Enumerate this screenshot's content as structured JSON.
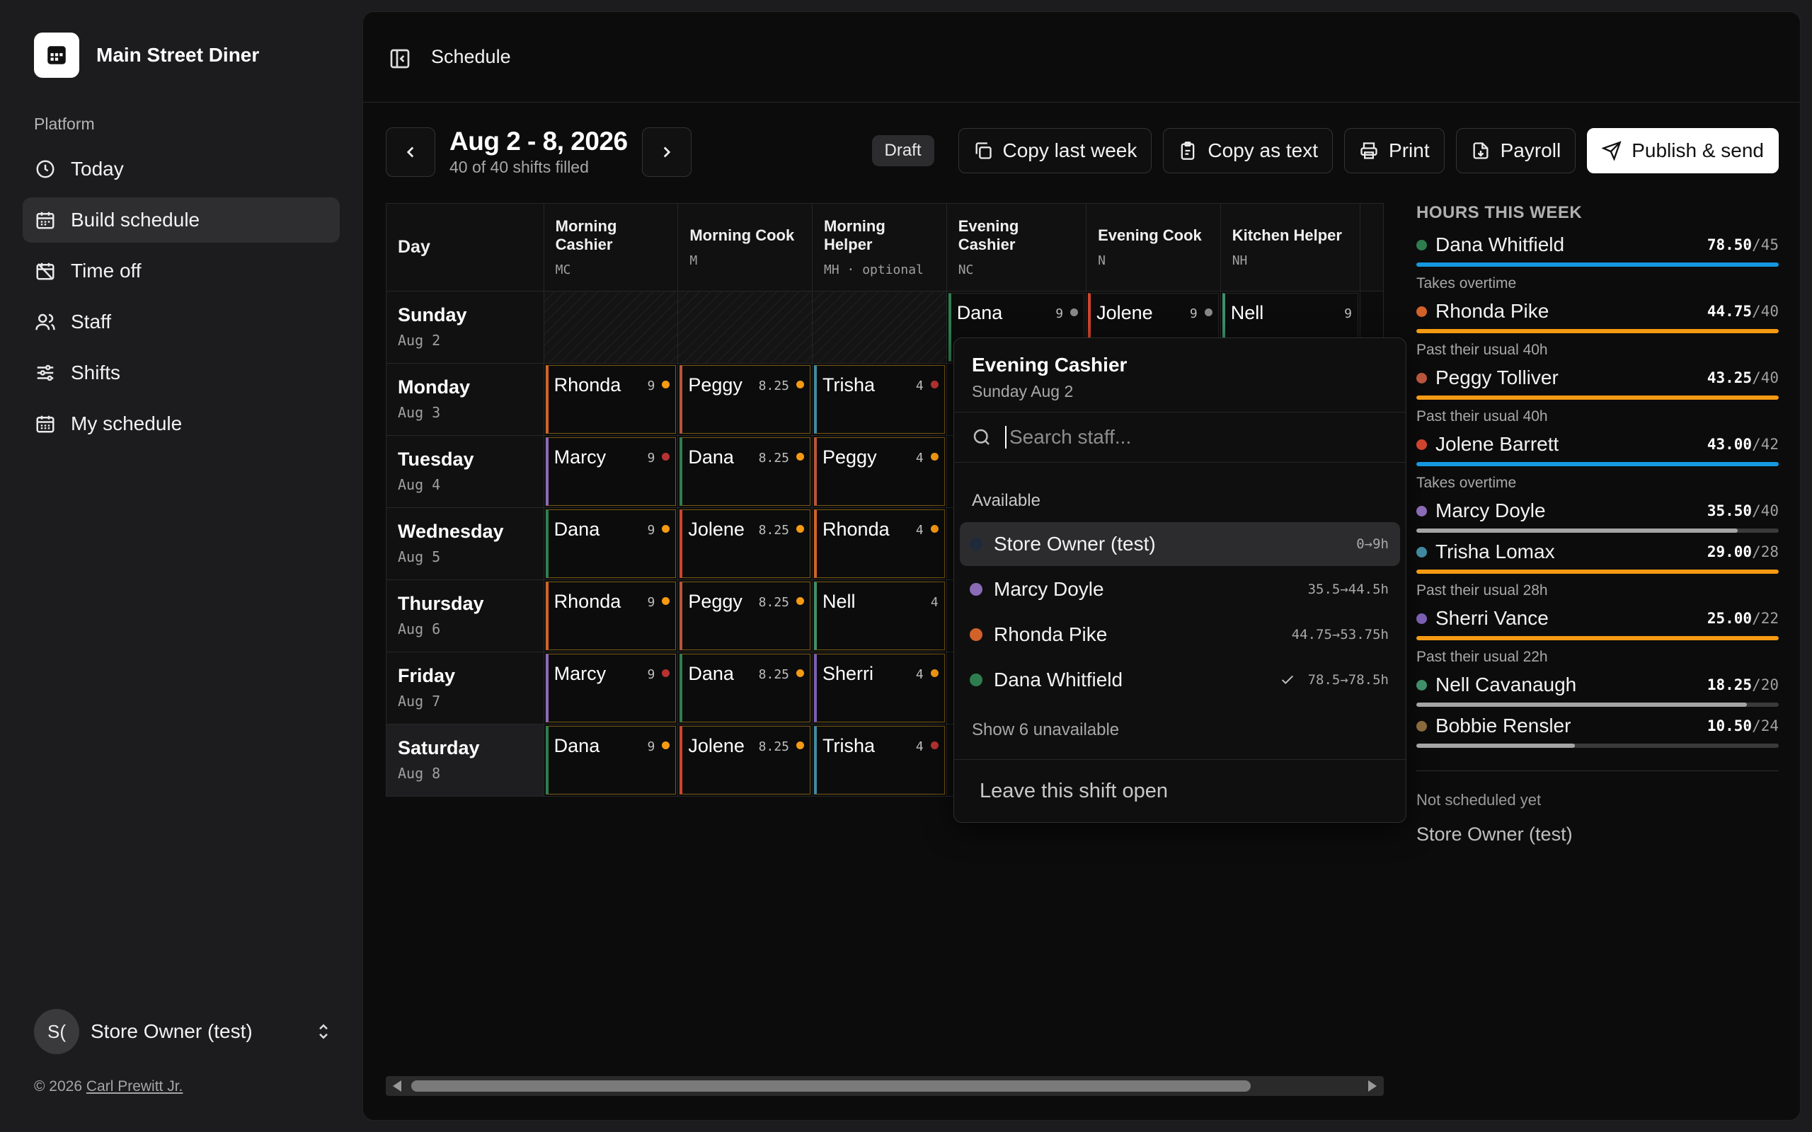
{
  "sidebar": {
    "brand": "Main Street Diner",
    "section": "Platform",
    "items": [
      {
        "label": "Today",
        "icon": "clock-icon"
      },
      {
        "label": "Build schedule",
        "icon": "calendar-icon"
      },
      {
        "label": "Time off",
        "icon": "calendar-off-icon"
      },
      {
        "label": "Staff",
        "icon": "users-icon"
      },
      {
        "label": "Shifts",
        "icon": "sliders-icon"
      },
      {
        "label": "My schedule",
        "icon": "calendar-grid-icon"
      }
    ],
    "user": {
      "initials": "S(",
      "name": "Store Owner (test)"
    },
    "copyright_prefix": "© 2026",
    "copyright_author": "Carl Prewitt Jr."
  },
  "header": {
    "title": "Schedule"
  },
  "week": {
    "title": "Aug 2 - 8, 2026",
    "subtitle": "40 of 40 shifts filled"
  },
  "toolbar": {
    "status": "Draft",
    "copy_last_week": "Copy last week",
    "copy_as_text": "Copy as text",
    "print": "Print",
    "payroll": "Payroll",
    "publish": "Publish & send"
  },
  "colors": {
    "dana": "#2e7d4f",
    "rhonda": "#d2622a",
    "peggy": "#b8553c",
    "jolene": "#d0442e",
    "marcy": "#8a6bb6",
    "trisha": "#3f8aa0",
    "sherri": "#7a5fb0",
    "nell": "#3f8f6a",
    "bobbie": "#8a6a3c",
    "orange": "#f59a12",
    "red": "#b83232",
    "gray": "#888888",
    "blue": "#1598e0",
    "barGray": "#a5a5a5"
  },
  "grid": {
    "day_header": "Day",
    "columns": [
      {
        "name": "Morning Cashier",
        "code": "MC"
      },
      {
        "name": "Morning Cook",
        "code": "M"
      },
      {
        "name": "Morning Helper",
        "code": "MH · optional"
      },
      {
        "name": "Evening Cashier",
        "code": "NC"
      },
      {
        "name": "Evening Cook",
        "code": "N"
      },
      {
        "name": "Kitchen Helper",
        "code": "NH"
      }
    ],
    "rows": [
      {
        "day": "Sunday",
        "date": "Aug 2",
        "cells": [
          null,
          null,
          null,
          {
            "name": "Dana",
            "hours": "9",
            "color": "dana",
            "dot": "gray"
          },
          {
            "name": "Jolene",
            "hours": "9",
            "color": "jolene",
            "dot": "gray"
          },
          {
            "name": "Nell",
            "hours": "9",
            "color": "nell",
            "dot": ""
          }
        ]
      },
      {
        "day": "Monday",
        "date": "Aug 3",
        "cells": [
          {
            "name": "Rhonda",
            "hours": "9",
            "color": "rhonda",
            "dot": "orange"
          },
          {
            "name": "Peggy",
            "hours": "8.25",
            "color": "peggy",
            "dot": "orange"
          },
          {
            "name": "Trisha",
            "hours": "4",
            "color": "trisha",
            "dot": "red"
          }
        ]
      },
      {
        "day": "Tuesday",
        "date": "Aug 4",
        "cells": [
          {
            "name": "Marcy",
            "hours": "9",
            "color": "marcy",
            "dot": "red"
          },
          {
            "name": "Dana",
            "hours": "8.25",
            "color": "dana",
            "dot": "orange"
          },
          {
            "name": "Peggy",
            "hours": "4",
            "color": "peggy",
            "dot": "orange"
          }
        ]
      },
      {
        "day": "Wednesday",
        "date": "Aug 5",
        "cells": [
          {
            "name": "Dana",
            "hours": "9",
            "color": "dana",
            "dot": "orange"
          },
          {
            "name": "Jolene",
            "hours": "8.25",
            "color": "jolene",
            "dot": "orange"
          },
          {
            "name": "Rhonda",
            "hours": "4",
            "color": "rhonda",
            "dot": "orange"
          }
        ]
      },
      {
        "day": "Thursday",
        "date": "Aug 6",
        "cells": [
          {
            "name": "Rhonda",
            "hours": "9",
            "color": "rhonda",
            "dot": "orange"
          },
          {
            "name": "Peggy",
            "hours": "8.25",
            "color": "peggy",
            "dot": "orange"
          },
          {
            "name": "Nell",
            "hours": "4",
            "color": "nell",
            "dot": ""
          }
        ]
      },
      {
        "day": "Friday",
        "date": "Aug 7",
        "cells": [
          {
            "name": "Marcy",
            "hours": "9",
            "color": "marcy",
            "dot": "red"
          },
          {
            "name": "Dana",
            "hours": "8.25",
            "color": "dana",
            "dot": "orange"
          },
          {
            "name": "Sherri",
            "hours": "4",
            "color": "sherri",
            "dot": "orange"
          }
        ]
      },
      {
        "day": "Saturday",
        "date": "Aug 8",
        "cells": [
          {
            "name": "Dana",
            "hours": "9",
            "color": "dana",
            "dot": "orange"
          },
          {
            "name": "Jolene",
            "hours": "8.25",
            "color": "jolene",
            "dot": "orange"
          },
          {
            "name": "Trisha",
            "hours": "4",
            "color": "trisha",
            "dot": "red"
          }
        ]
      }
    ]
  },
  "popover": {
    "title": "Evening Cashier",
    "subtitle": "Sunday Aug 2",
    "search_placeholder": "Search staff...",
    "available_label": "Available",
    "items": [
      {
        "name": "Store Owner (test)",
        "hours": "0→9h",
        "color": "#1f2b3a"
      },
      {
        "name": "Marcy Doyle",
        "hours": "35.5→44.5h",
        "color": "#8a6bb6"
      },
      {
        "name": "Rhonda Pike",
        "hours": "44.75→53.75h",
        "color": "#d2622a"
      },
      {
        "name": "Dana Whitfield",
        "hours": "78.5→78.5h",
        "color": "#2e7d4f",
        "checked": true
      }
    ],
    "show_unavailable": "Show 6 unavailable",
    "leave_open": "Leave this shift open"
  },
  "hours": {
    "title": "HOURS THIS WEEK",
    "staff": [
      {
        "name": "Dana Whitfield",
        "value": "78.50",
        "target": "/45",
        "color": "#2e7d4f",
        "bar": "#1598e0",
        "fraction": 1.0,
        "note": "Takes overtime"
      },
      {
        "name": "Rhonda Pike",
        "value": "44.75",
        "target": "/40",
        "color": "#d2622a",
        "bar": "#f59a12",
        "fraction": 1.0,
        "note": "Past their usual 40h"
      },
      {
        "name": "Peggy Tolliver",
        "value": "43.25",
        "target": "/40",
        "color": "#b8553c",
        "bar": "#f59a12",
        "fraction": 1.0,
        "note": "Past their usual 40h"
      },
      {
        "name": "Jolene Barrett",
        "value": "43.00",
        "target": "/42",
        "color": "#d0442e",
        "bar": "#1598e0",
        "fraction": 1.0,
        "note": "Takes overtime"
      },
      {
        "name": "Marcy Doyle",
        "value": "35.50",
        "target": "/40",
        "color": "#8a6bb6",
        "bar": "#a5a5a5",
        "fraction": 0.8875,
        "note": ""
      },
      {
        "name": "Trisha Lomax",
        "value": "29.00",
        "target": "/28",
        "color": "#3f8aa0",
        "bar": "#f59a12",
        "fraction": 1.0,
        "note": "Past their usual 28h"
      },
      {
        "name": "Sherri Vance",
        "value": "25.00",
        "target": "/22",
        "color": "#7a5fb0",
        "bar": "#f59a12",
        "fraction": 1.0,
        "note": "Past their usual 22h"
      },
      {
        "name": "Nell Cavanaugh",
        "value": "18.25",
        "target": "/20",
        "color": "#3f8f6a",
        "bar": "#a5a5a5",
        "fraction": 0.9125,
        "note": ""
      },
      {
        "name": "Bobbie Rensler",
        "value": "10.50",
        "target": "/24",
        "color": "#8a6a3c",
        "bar": "#a5a5a5",
        "fraction": 0.4375,
        "note": ""
      }
    ],
    "not_scheduled_label": "Not scheduled yet",
    "not_scheduled": [
      "Store Owner (test)"
    ]
  }
}
